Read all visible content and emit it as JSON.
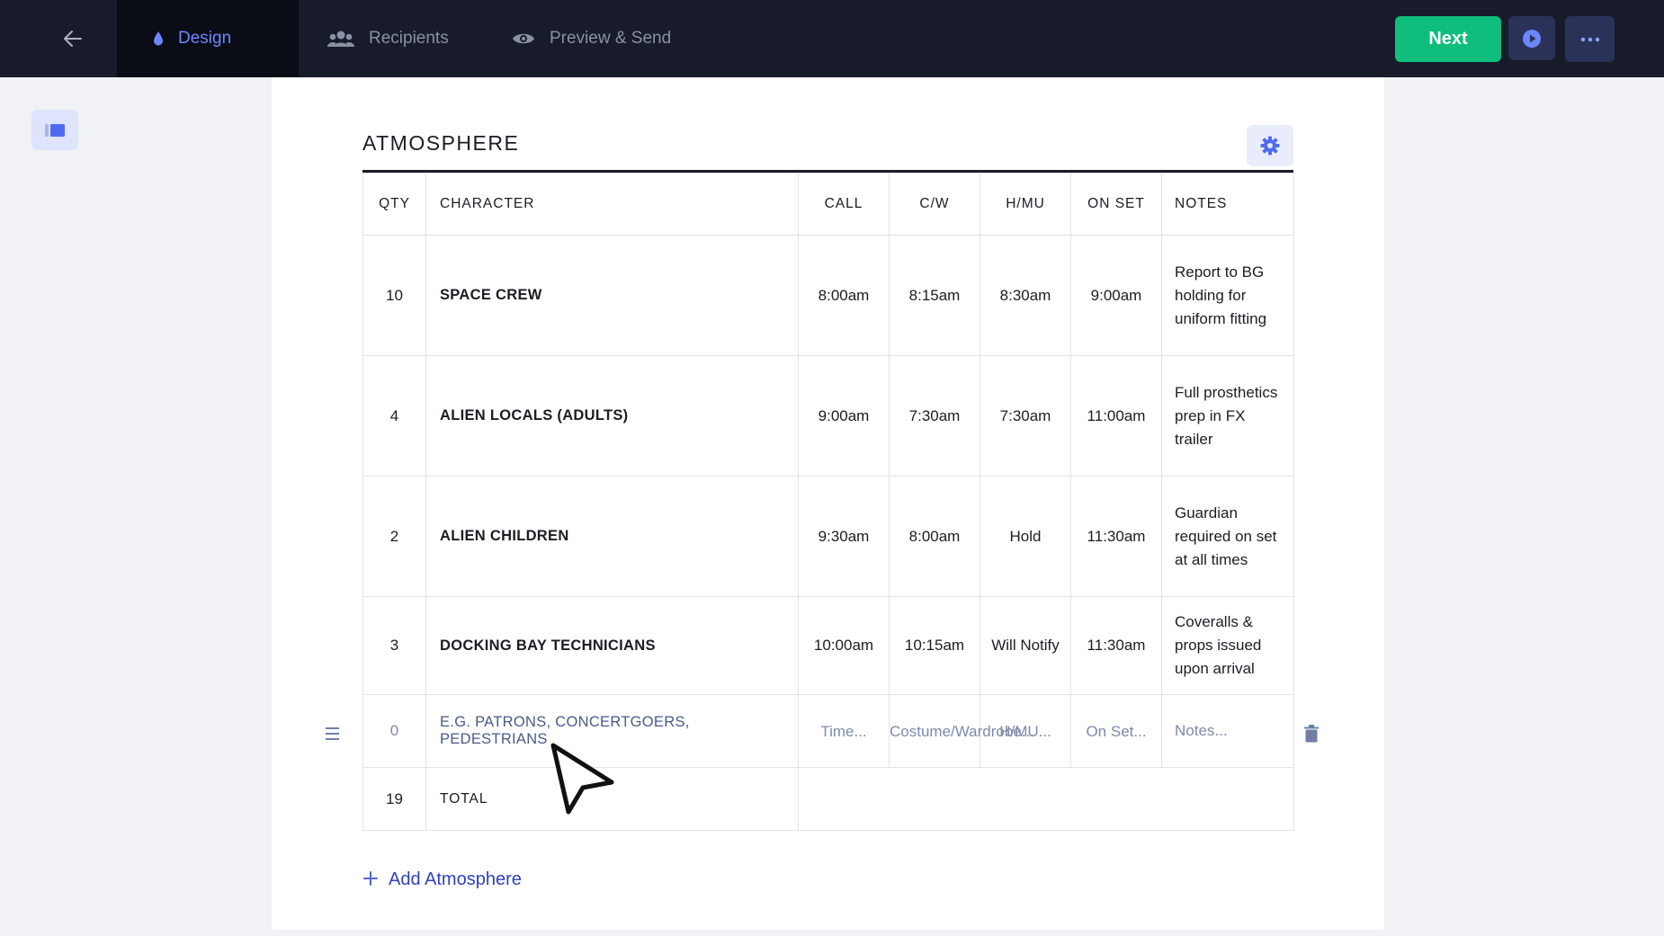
{
  "nav": {
    "tabs": [
      {
        "label": "Design",
        "icon": "drop-icon",
        "active": true
      },
      {
        "label": "Recipients",
        "icon": "people-icon",
        "active": false
      },
      {
        "label": "Preview & Send",
        "icon": "eye-icon",
        "active": false
      }
    ],
    "next_label": "Next"
  },
  "section": {
    "title": "ATMOSPHERE",
    "add_label": "Add Atmosphere"
  },
  "table": {
    "headers": [
      "QTY",
      "CHARACTER",
      "CALL",
      "C/W",
      "H/MU",
      "ON SET",
      "NOTES"
    ],
    "rows": [
      {
        "qty": "10",
        "character": "SPACE CREW",
        "call": "8:00am",
        "cw": "8:15am",
        "hmu": "8:30am",
        "on_set": "9:00am",
        "notes": "Report to BG holding for uniform fitting"
      },
      {
        "qty": "4",
        "character": "ALIEN LOCALS (ADULTS)",
        "call": "9:00am",
        "cw": "7:30am",
        "hmu": "7:30am",
        "on_set": "11:00am",
        "notes": "Full prosthetics prep in FX trailer"
      },
      {
        "qty": "2",
        "character": "ALIEN CHILDREN",
        "call": "9:30am",
        "cw": "8:00am",
        "hmu": "Hold",
        "on_set": "11:30am",
        "notes": "Guardian required on set at all times"
      },
      {
        "qty": "3",
        "character": "DOCKING BAY TECHNICIANS",
        "call": "10:00am",
        "cw": "10:15am",
        "hmu": "Will Notify",
        "on_set": "11:30am",
        "notes": "Coveralls & props issued upon arrival"
      }
    ],
    "new_row": {
      "qty": "0",
      "character_placeholder": "E.G. PATRONS, CONCERTGOERS, PEDESTRIANS",
      "call_placeholder": "Time...",
      "cw_placeholder": "Costume/Wardrobe...",
      "hmu_placeholder": "H/MU...",
      "on_set_placeholder": "On Set...",
      "notes_placeholder": "Notes..."
    },
    "total": {
      "qty": "19",
      "label": "TOTAL"
    }
  },
  "colors": {
    "topbar": "#171b2a",
    "accent": "#6b86ff",
    "next_button": "#0fbe7c",
    "link": "#2f3fc0"
  }
}
